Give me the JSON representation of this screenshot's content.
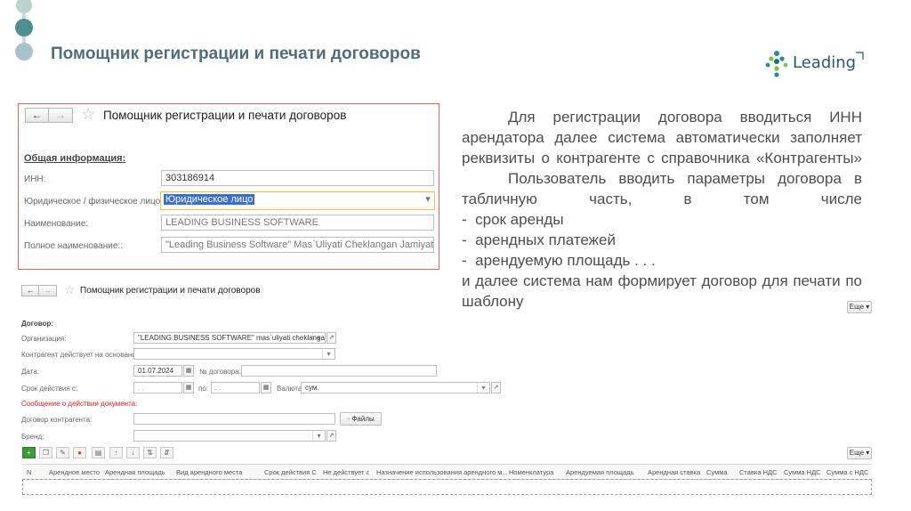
{
  "slide": {
    "title": "Помощник регистрации и печати договоров",
    "logo_text": "Leading"
  },
  "form1": {
    "title": "Помощник регистрации и печати договоров",
    "section": "Общая информация:",
    "fields": [
      {
        "label": "ИНН:",
        "value": "303186914"
      },
      {
        "label": "Юридическое / физическое лицо:",
        "value": "Юридическое лицо"
      },
      {
        "label": "Наименование:",
        "value": "LEADING BUSINESS SOFTWARE"
      },
      {
        "label": "Полное наименование::",
        "value": "\"Leading Business Software\" Mas`Uliyati Cheklangan Jamiyati"
      }
    ]
  },
  "description": {
    "p1": "Для регистрации договора вводиться ИНН арендатора далее система автоматически заполняет реквизиты о контрагенте с справочника «Контрагенты»",
    "p2": "Пользователь вводить параметры договора в табличную часть, в том числе",
    "items": [
      "срок аренды",
      "арендных платежей",
      "арендуемую площадь . . ."
    ],
    "p3": "и далее система нам формирует договор для печати по шаблону"
  },
  "form2": {
    "title": "Помощник регистрации и печати договоров",
    "more_label": "Еще",
    "section": "Договор:",
    "org_label": "Организация:",
    "org_value": "\"LEADING BUSINESS SOFTWARE\" mas`uliyati cheklangan j",
    "basis_label": "Контрагент действует на основании:",
    "date_label": "Дата:",
    "date_value": "01.07.2024",
    "number_label": "№ договора::",
    "period_label": "Срок действия с:",
    "date_mask": ". .",
    "to_label": "по:",
    "currency_label": "Валюта:",
    "currency_value": "сум.",
    "warning": "Сообщение о действии документа:",
    "counterparty_contract_label": "Договор контрагента:",
    "files_label": "Файлы",
    "brand_label": "Бренд:",
    "table_more_label": "Еще",
    "columns": [
      "N",
      "Арендное место",
      "Арендная площадь",
      "Вид арендного места",
      "Срок действия С",
      "Не действует с",
      "Назначение использования арендного м...",
      "Номенклатура",
      "Арендуемая площадь",
      "Арендная ставка",
      "Сумма",
      "Ставка НДС",
      "Сумма НДС",
      "Сумма с НДС"
    ]
  },
  "colors": {
    "title": "#4f6d7a",
    "accent": "#2c8c8c",
    "highlight_border": "#e36363",
    "warning": "#e02020"
  }
}
